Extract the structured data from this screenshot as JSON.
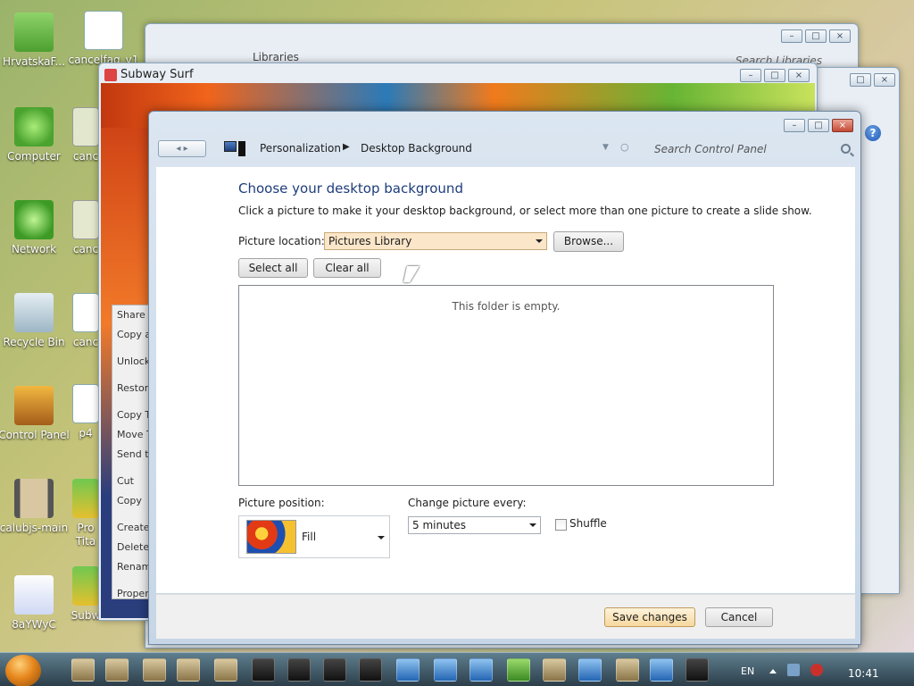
{
  "desktop": {
    "icons": [
      {
        "label": "HrvatskaF..."
      },
      {
        "label": "cancelfaq_v1"
      },
      {
        "label": "Computer"
      },
      {
        "label": "canc"
      },
      {
        "label": "Network"
      },
      {
        "label": "canc"
      },
      {
        "label": "Recycle Bin"
      },
      {
        "label": "canc"
      },
      {
        "label": "Control Panel"
      },
      {
        "label": "p4"
      },
      {
        "label": "calubjs-main"
      },
      {
        "label": "Pro Tita"
      },
      {
        "label": "8aYWyC"
      },
      {
        "label": "Subw"
      }
    ]
  },
  "libraries_window": {
    "breadcrumb": "Libraries",
    "search_placeholder": "Search Libraries"
  },
  "subway_window": {
    "title": "Subway Surf",
    "context_menu": [
      "Share w",
      "Copy a",
      "Unlock",
      "Restore",
      "Copy To",
      "Move T",
      "Send to",
      "Cut",
      "Copy",
      "Create",
      "Delete",
      "Renam",
      "Proper"
    ]
  },
  "dialog": {
    "breadcrumb": {
      "item1": "Personalization",
      "item2": "Desktop Background"
    },
    "search_placeholder": "Search Control Panel",
    "heading": "Choose your desktop background",
    "instructions": "Click a picture to make it your desktop background, or select more than one picture to create a slide show.",
    "picture_location_label": "Picture location:",
    "picture_location_value": "Pictures Library",
    "browse_label": "Browse...",
    "select_all_label": "Select all",
    "clear_all_label": "Clear all",
    "empty_message": "This folder is empty.",
    "picture_position_label": "Picture position:",
    "picture_position_value": "Fill",
    "change_picture_label": "Change picture every:",
    "change_picture_value": "5 minutes",
    "shuffle_label": "Shuffle",
    "shuffle_checked": false,
    "save_label": "Save changes",
    "cancel_label": "Cancel"
  },
  "taskbar": {
    "language": "EN",
    "clock": "10:41"
  },
  "colors": {
    "heading": "#1e3d7b",
    "location_highlight": "#fbe6c9",
    "primary_button": "#f6d79d"
  }
}
